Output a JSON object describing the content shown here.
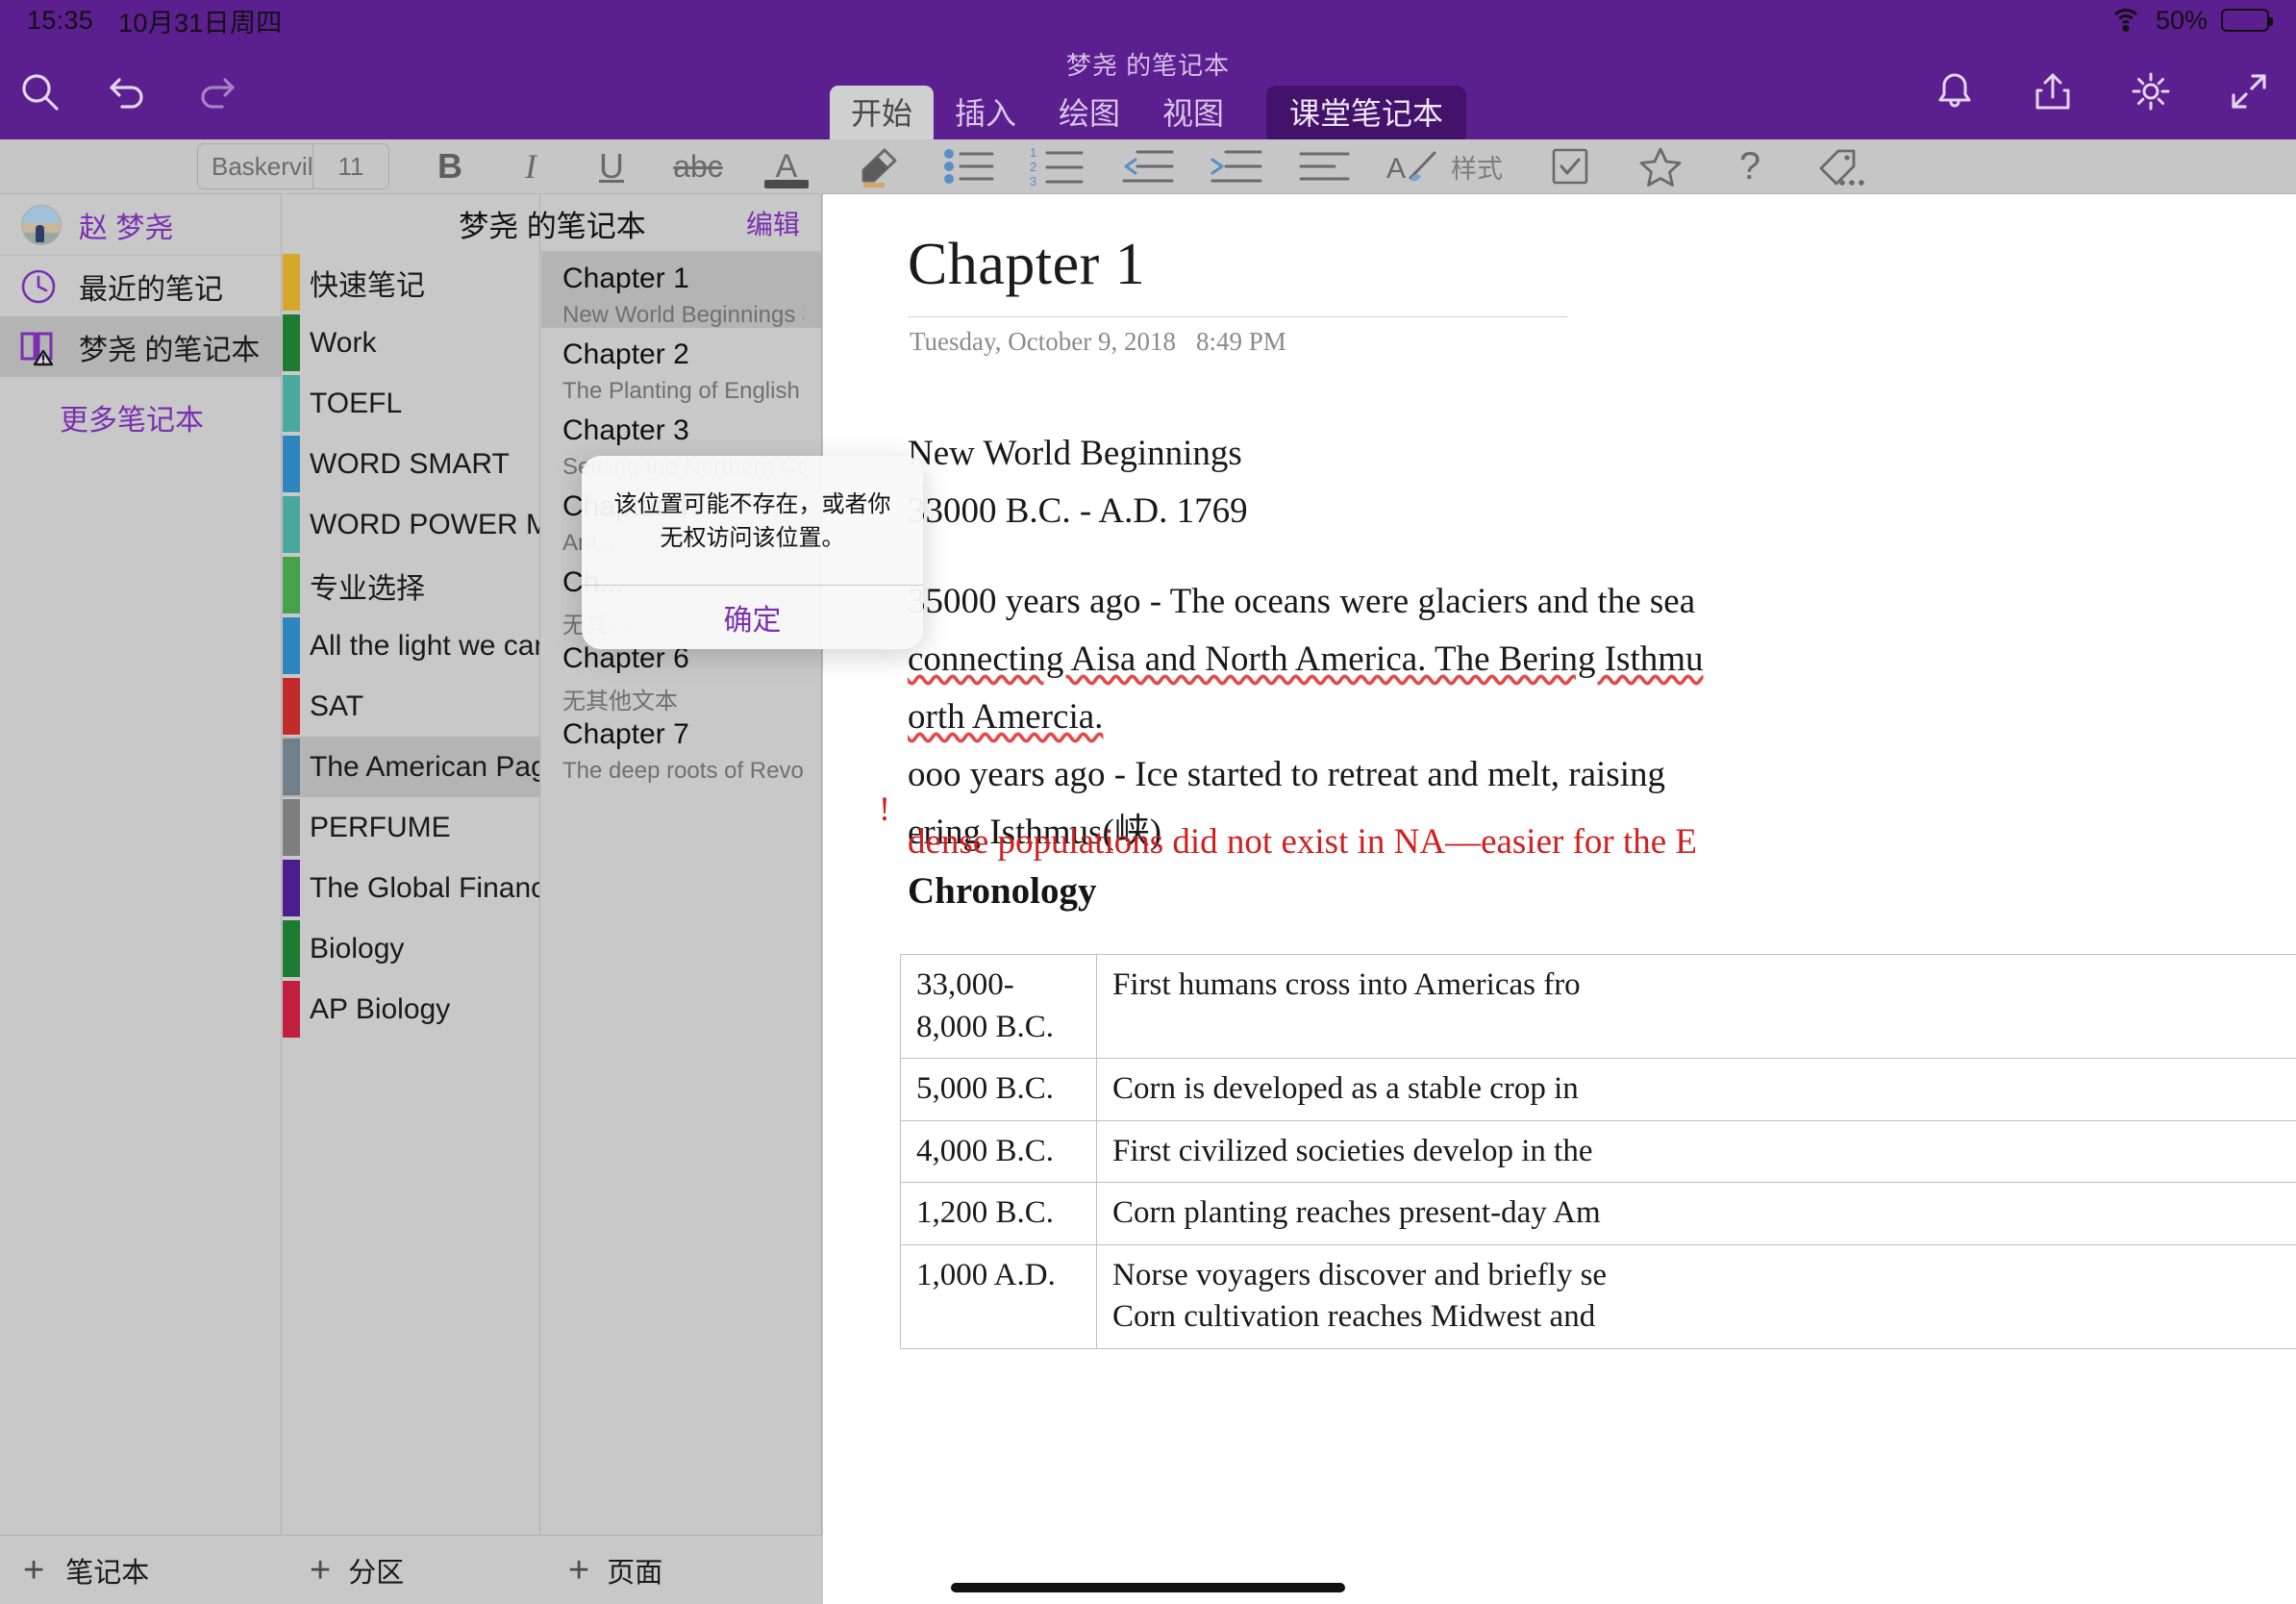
{
  "status_bar": {
    "time": "15:35",
    "date": "10月31日周四",
    "battery_percent": "50%",
    "wifi_icon": "wifi-icon",
    "battery_icon": "battery-icon"
  },
  "ribbon": {
    "notebook_title": "梦尧 的笔记本",
    "left_icons": [
      "search-icon",
      "undo-icon",
      "redo-icon"
    ],
    "right_icons": [
      "bell-icon",
      "share-icon",
      "gear-icon",
      "expand-icon"
    ],
    "tabs": [
      {
        "label": "开始",
        "active": true
      },
      {
        "label": "插入",
        "active": false
      },
      {
        "label": "绘图",
        "active": false
      },
      {
        "label": "视图",
        "active": false
      }
    ],
    "class_notebook_tab": "课堂笔记本"
  },
  "format_bar": {
    "font_name": "Baskerville",
    "font_size": "11",
    "bold": "B",
    "italic": "I",
    "underline": "U",
    "strikethrough": "abc",
    "styles_label": "样式",
    "icons": [
      "font-color-icon",
      "highlighter-icon",
      "bullet-list-icon",
      "numbered-list-icon",
      "decrease-indent-icon",
      "increase-indent-icon",
      "align-left-icon",
      "styles-icon",
      "checkbox-icon",
      "star-icon",
      "help-icon",
      "tag-icon"
    ]
  },
  "sidebar": {
    "account_name": "赵 梦尧",
    "avatar_icon": "avatar",
    "items": [
      {
        "label": "最近的笔记",
        "icon": "clock-icon",
        "selected": false
      },
      {
        "label": "梦尧 的笔记本",
        "icon": "notebook-warning-icon",
        "selected": true
      }
    ],
    "more_notebooks": "更多笔记本",
    "footer_label": "笔记本",
    "footer_icon": "plus-icon"
  },
  "sections": {
    "items": [
      {
        "label": "快速笔记",
        "color": "#d6a829",
        "selected": false
      },
      {
        "label": "Work",
        "color": "#1e7b34",
        "selected": false
      },
      {
        "label": "TOEFL",
        "color": "#49a9a0",
        "selected": false
      },
      {
        "label": "WORD SMART",
        "color": "#2f85bd",
        "selected": false
      },
      {
        "label": "WORD POWER MAD...",
        "color": "#4aa79e",
        "selected": false
      },
      {
        "label": "专业选择",
        "color": "#46a24a",
        "selected": false
      },
      {
        "label": "All the light we cann...",
        "color": "#2f85bd",
        "selected": false
      },
      {
        "label": "SAT",
        "color": "#c22b2b",
        "selected": false
      },
      {
        "label": "The American Page...",
        "color": "#6f7f8c",
        "selected": true
      },
      {
        "label": "PERFUME",
        "color": "#7e7e7e",
        "selected": false
      },
      {
        "label": "The Global Financial...",
        "color": "#4a1e8c",
        "selected": false
      },
      {
        "label": "Biology",
        "color": "#1e7b34",
        "selected": false
      },
      {
        "label": "AP Biology",
        "color": "#c2203f",
        "selected": false
      }
    ],
    "footer_label": "分区",
    "footer_icon": "plus-icon"
  },
  "pages": {
    "header_title": "梦尧 的笔记本",
    "edit_label": "编辑",
    "items": [
      {
        "title": "Chapter 1",
        "subtitle": "New World Beginnings  3300...",
        "selected": true
      },
      {
        "title": "Chapter 2",
        "subtitle": "The Planting of English Ameri...",
        "selected": false
      },
      {
        "title": "Chapter 3",
        "subtitle": "Settling the Northern Colonie...",
        "selected": false
      },
      {
        "title": "Chapter 4",
        "subtitle": "Am...",
        "selected": false
      },
      {
        "title": "Ch...",
        "subtitle": "无其...",
        "selected": false
      },
      {
        "title": "Chapter 6",
        "subtitle": "无其他文本",
        "selected": false
      },
      {
        "title": "Chapter 7",
        "subtitle": "The deep roots of Revolution...",
        "selected": false
      }
    ],
    "footer_label": "页面",
    "footer_icon": "plus-icon"
  },
  "note": {
    "title": "Chapter 1",
    "date": "Tuesday, October 9, 2018",
    "time": "8:49 PM",
    "heading_1": "New World Beginnings",
    "heading_2": "33000 B.C. - A.D. 1769",
    "para_1": "35000 years ago - The oceans were glaciers and the sea",
    "para_2": "connecting Aisa and North America. The Bering Isthmu",
    "para_3": "orth Amercia.",
    "para_4": "ooo years ago - Ice started to retreat and melt, raising",
    "para_5": "ering Isthmus(峡)",
    "red_marker": "!",
    "red_note": "dense populations did not exist in NA—easier for the E",
    "chronology_heading": "Chronology",
    "chronology_rows": [
      {
        "period": "33,000-8,000 B.C.",
        "event": "First humans cross into Americas fro"
      },
      {
        "period": "5,000 B.C.",
        "event": "Corn is developed as a stable crop in "
      },
      {
        "period": "4,000 B.C.",
        "event": "First civilized societies develop in the"
      },
      {
        "period": "1,200 B.C.",
        "event": "Corn planting reaches present-day Am"
      },
      {
        "period": "1,000 A.D.",
        "event": "Norse voyagers discover and briefly se\nCorn cultivation reaches Midwest and"
      }
    ]
  },
  "alert": {
    "message": "该位置可能不存在，或者你无权访问该位置。",
    "ok_label": "确定"
  },
  "colors": {
    "brand_purple": "#5b1f8f",
    "accent_purple": "#7a2fb0",
    "chrome_grey": "#c8c8c8",
    "selected_grey": "#b4b4b4"
  }
}
